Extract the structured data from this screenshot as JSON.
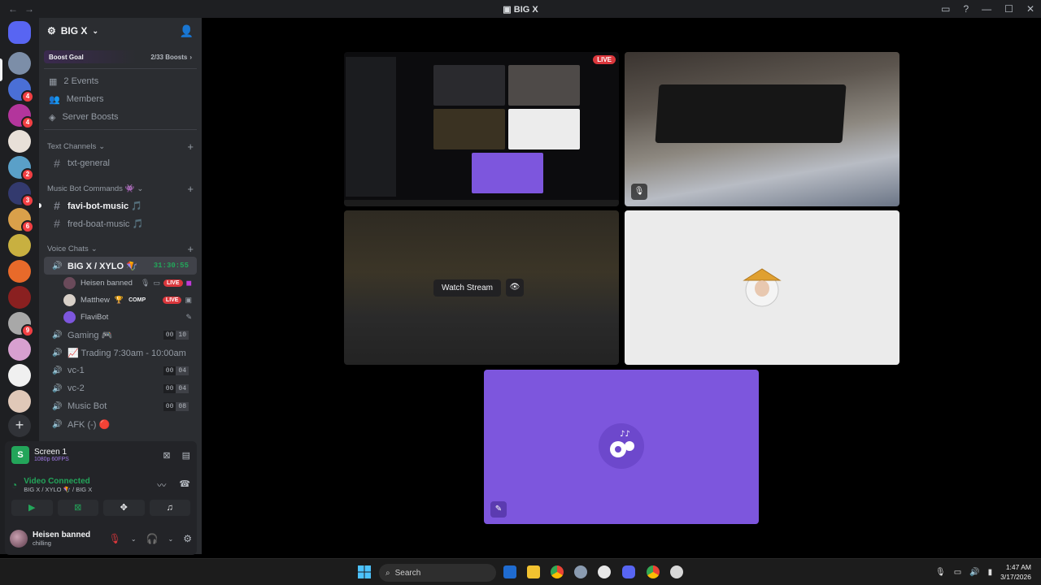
{
  "window": {
    "title": "BIG X",
    "nav_back": "←",
    "nav_forward": "→"
  },
  "guild": {
    "name": "BIG X",
    "boost": {
      "label": "Boost Goal",
      "progress": "2/33 Boosts"
    },
    "nav": [
      {
        "icon": "calendar-icon",
        "label": "2 Events"
      },
      {
        "icon": "members-icon",
        "label": "Members"
      },
      {
        "icon": "boost-icon",
        "label": "Server Boosts"
      }
    ]
  },
  "categories": {
    "text": "Text Channels",
    "music": "Music Bot Commands 👾",
    "voice": "Voice Chats"
  },
  "text_channels": [
    {
      "name": "txt-general"
    }
  ],
  "music_channels": [
    {
      "name": "favi-bot-music 🎵"
    },
    {
      "name": "fred-boat-music 🎵"
    }
  ],
  "active_voice": {
    "name": "BIG X / XYLO 🪁",
    "timer": "31:30:55"
  },
  "voice_users": [
    {
      "name": "Heisen banned",
      "live": "LIVE",
      "extra": ""
    },
    {
      "name": "Matthew",
      "live": "LIVE",
      "extra": "COMP"
    },
    {
      "name": "FlaviBot",
      "live": "",
      "extra": ""
    }
  ],
  "voice_channels": [
    {
      "name": "Gaming 🎮",
      "c1": "00",
      "c2": "10"
    },
    {
      "name": "📈 Trading 7:30am - 10:00am (...",
      "c1": "",
      "c2": ""
    },
    {
      "name": "vc-1",
      "c1": "00",
      "c2": "04"
    },
    {
      "name": "vc-2",
      "c1": "00",
      "c2": "04"
    },
    {
      "name": "Music Bot",
      "c1": "00",
      "c2": "08"
    },
    {
      "name": "AFK (-) 🔴",
      "c1": "",
      "c2": ""
    }
  ],
  "screen_share": {
    "title": "Screen 1",
    "quality": "1080p 60FPS"
  },
  "connection": {
    "status": "Video Connected",
    "location": "BIG X / XYLO 🪁 / BIG X"
  },
  "user": {
    "name": "Heisen banned",
    "status": "chilling"
  },
  "stage": {
    "watch_label": "Watch Stream",
    "live_label": "LIVE"
  },
  "taskbar": {
    "search_placeholder": "Search",
    "time": "1:47 AM",
    "date": "3/17/2026"
  },
  "colors": {
    "accent": "#5865f2",
    "live": "#da373c",
    "online": "#23a55a",
    "bot_tile": "#7d56dd"
  }
}
